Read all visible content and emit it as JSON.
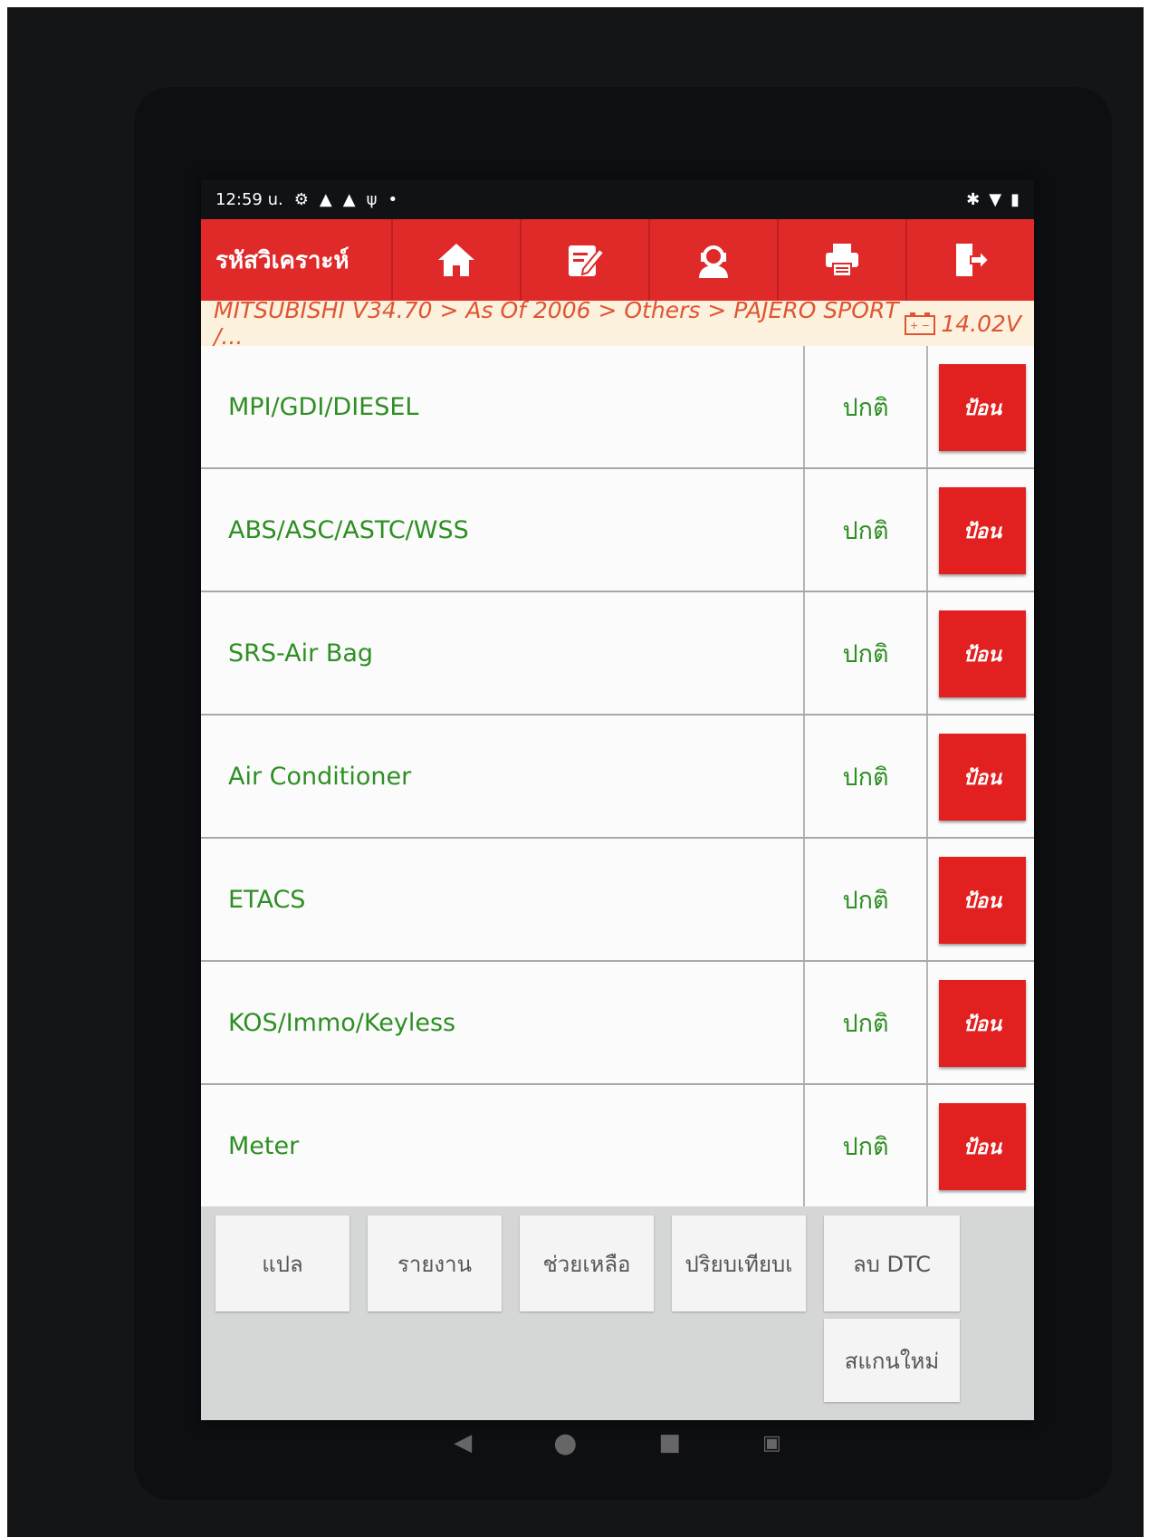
{
  "statusbar": {
    "time": "12:59 u."
  },
  "header": {
    "title": "รหัสวิเคราะห์",
    "buttons": [
      "home",
      "edit-report",
      "support",
      "print",
      "exit"
    ]
  },
  "breadcrumb": {
    "path": "MITSUBISHI V34.70 > As Of 2006 > Others > PAJERO SPORT /...",
    "voltage": "14.02V"
  },
  "systems": [
    {
      "name": "MPI/GDI/DIESEL",
      "status": "ปกติ",
      "action": "ป้อน"
    },
    {
      "name": "ABS/ASC/ASTC/WSS",
      "status": "ปกติ",
      "action": "ป้อน"
    },
    {
      "name": "SRS-Air Bag",
      "status": "ปกติ",
      "action": "ป้อน"
    },
    {
      "name": "Air Conditioner",
      "status": "ปกติ",
      "action": "ป้อน"
    },
    {
      "name": "ETACS",
      "status": "ปกติ",
      "action": "ป้อน"
    },
    {
      "name": "KOS/Immo/Keyless",
      "status": "ปกติ",
      "action": "ป้อน"
    },
    {
      "name": "Meter",
      "status": "ปกติ",
      "action": "ป้อน"
    }
  ],
  "toolbar": {
    "translate": "แปล",
    "report": "รายงาน",
    "help": "ช่วยเหลือ",
    "compare": "ปริยบเทียบเ",
    "clear_dtc": "ลบ DTC",
    "rescan": "สแกนใหม่"
  },
  "colors": {
    "header_red": "#e02a2a",
    "button_red": "#e22020",
    "text_green": "#2e8f23",
    "breadcrumb_orange": "#e05432"
  }
}
